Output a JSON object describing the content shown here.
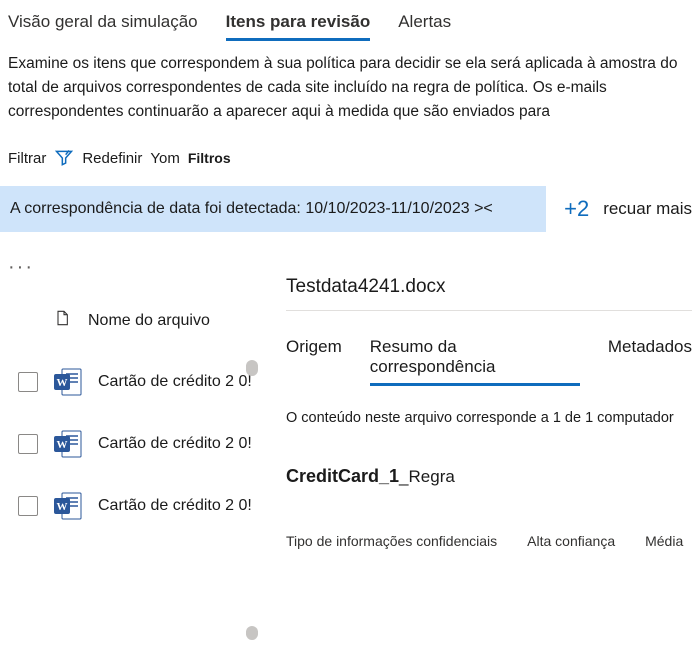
{
  "tabs": {
    "overview": "Visão geral da simulação",
    "review": "Itens para revisão",
    "alerts": "Alertas"
  },
  "description": "Examine os itens que correspondem à sua política para decidir se ela será aplicada à amostra do total de arquivos correspondentes de cada site incluído na regra de política. Os e-mails correspondentes continuarão a aparecer aqui à medida que são enviados para",
  "filterbar": {
    "filter": "Filtrar",
    "reset": "Redefinir",
    "yom": "Yom",
    "filters": "Filtros"
  },
  "pill": "A correspondência de data foi detectada: 10/10/2023-11/10/2023 ><",
  "plus": "+2",
  "more": "recuar mais",
  "list": {
    "moreMenu": "···",
    "fileHeader": "Nome do arquivo",
    "rows": [
      {
        "name": "Cartão de crédito 2 0!"
      },
      {
        "name": "Cartão de crédito 2 0!"
      },
      {
        "name": "Cartão de crédito 2 0!"
      }
    ]
  },
  "detail": {
    "title": "Testdata4241.docx",
    "tabs": {
      "source": "Origem",
      "summary": "Resumo da correspondência",
      "metadata": "Metadados"
    },
    "summaryText": "O conteúdo neste arquivo corresponde a 1 de 1 computador",
    "ruleName": "CreditCard_1",
    "ruleSuffix": "_Regra",
    "confHeader": {
      "sit": "Tipo de informações confidenciais",
      "high": "Alta confiança",
      "med": "Média"
    }
  }
}
